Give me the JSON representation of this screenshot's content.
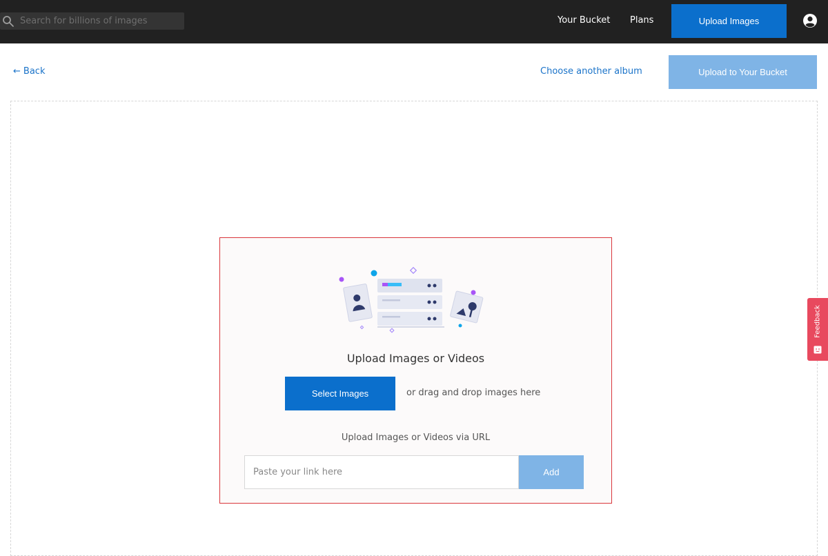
{
  "header": {
    "search_placeholder": "Search for billions of images",
    "nav_your_bucket": "Your Bucket",
    "nav_plans": "Plans",
    "upload_images_label": "Upload Images",
    "account_icon": "account-circle-icon"
  },
  "subheader": {
    "back_arrow": "←",
    "back_label": "Back",
    "choose_album_label": "Choose another album",
    "upload_bucket_label": "Upload to Your Bucket"
  },
  "upload_panel": {
    "illustration": "upload-illustration",
    "title": "Upload Images or Videos",
    "select_images_label": "Select Images",
    "drag_text": "or drag and drop images here",
    "url_label": "Upload Images or Videos via URL",
    "url_placeholder": "Paste your link here",
    "add_label": "Add"
  },
  "feedback": {
    "label": "Feedback",
    "icon": "feedback-icon"
  },
  "colors": {
    "topbar": "#212121",
    "primary": "#0b6fcc",
    "primary_disabled": "#7fb4e6",
    "link": "#1a73c9",
    "panel_border": "#d9353a",
    "feedback": "#e8495e"
  }
}
